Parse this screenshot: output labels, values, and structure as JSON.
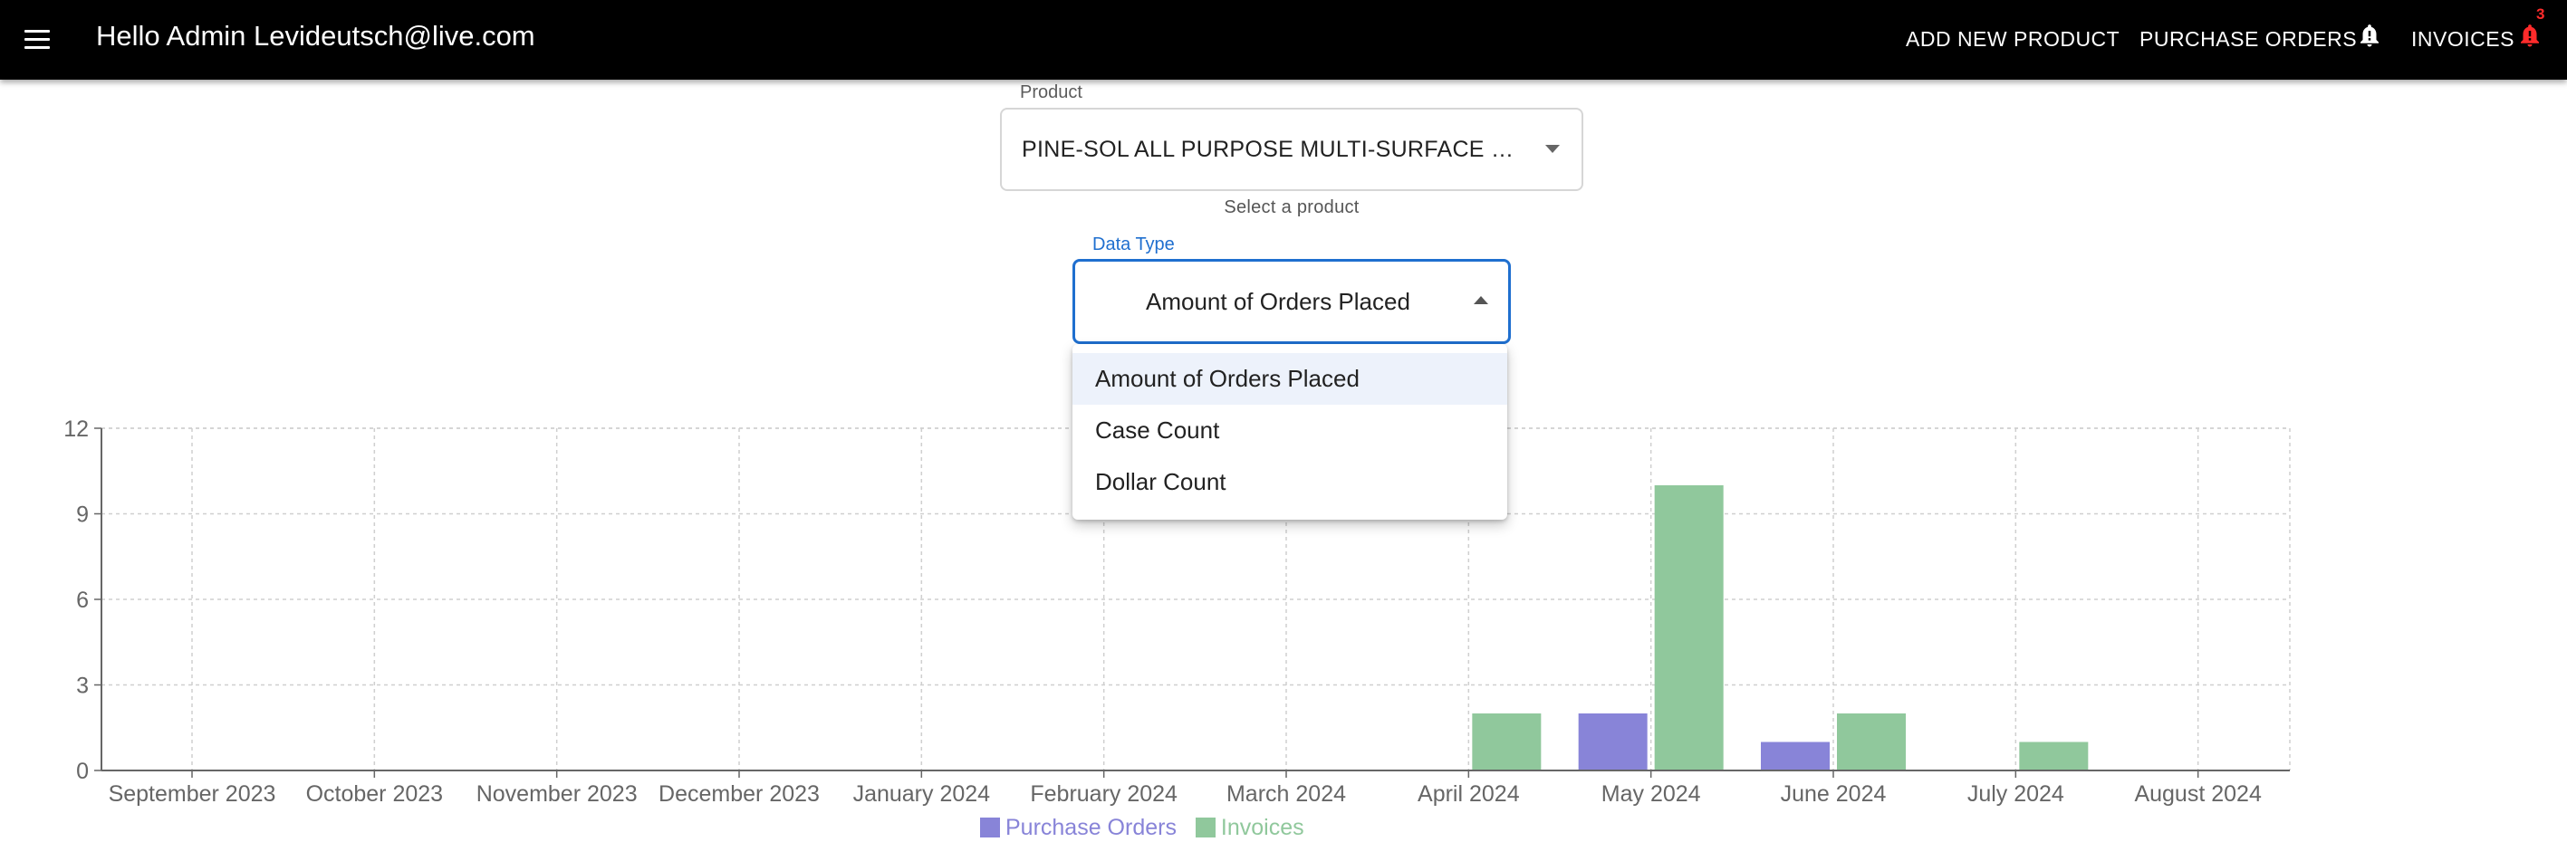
{
  "header": {
    "greeting": "Hello Admin Levideutsch@live.com",
    "nav": {
      "add_product": "ADD NEW PRODUCT",
      "purchase_orders": "PURCHASE ORDERS",
      "invoices": "INVOICES",
      "invoices_badge": "3"
    },
    "icons": {
      "menu": "hamburger-menu-icon",
      "po_bell": "bell-alert-icon",
      "invoice_bell": "bell-alert-icon"
    },
    "colors": {
      "background": "#000000",
      "badge": "#ff2b2b"
    }
  },
  "filters": {
    "product": {
      "label": "Product",
      "value": "PINE-SOL ALL PURPOSE MULTI-SURFACE CLEANER",
      "helper": "Select a product"
    },
    "data_type": {
      "label": "Data Type",
      "value": "Amount of Orders Placed",
      "options": [
        "Amount of Orders Placed",
        "Case Count",
        "Dollar Count"
      ],
      "selected_index": 0,
      "accent_color": "#1f6fcf"
    }
  },
  "chart_data": {
    "type": "bar",
    "categories": [
      "September 2023",
      "October 2023",
      "November 2023",
      "December 2023",
      "January 2024",
      "February 2024",
      "March 2024",
      "April 2024",
      "May 2024",
      "June 2024",
      "July 2024",
      "August 2024"
    ],
    "series": [
      {
        "name": "Purchase Orders",
        "color": "#8884d8",
        "values": [
          0,
          0,
          0,
          0,
          0,
          0,
          0,
          0,
          2,
          1,
          0,
          0
        ]
      },
      {
        "name": "Invoices",
        "color": "#90c89c",
        "values": [
          0,
          0,
          0,
          0,
          0,
          0,
          0,
          2,
          10,
          2,
          1,
          0
        ]
      }
    ],
    "yticks": [
      0,
      3,
      6,
      9,
      12
    ],
    "ylim": [
      0,
      12
    ],
    "grid": true,
    "legend_position": "bottom-center"
  }
}
